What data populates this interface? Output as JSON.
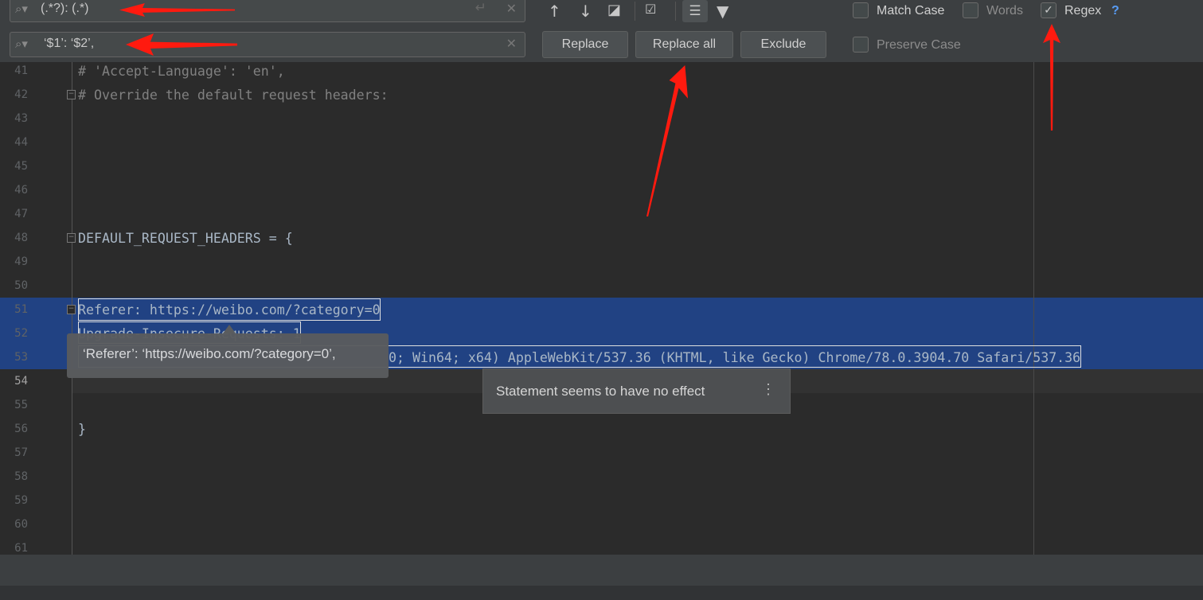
{
  "find": {
    "search_value": "(.*?): (.*)",
    "replace_value": "‘$1’: ‘$2’,"
  },
  "buttons": {
    "replace": "Replace",
    "replace_all": "Replace all",
    "exclude": "Exclude"
  },
  "options": {
    "match_case": {
      "label": "Match Case",
      "checked": false
    },
    "words": {
      "label": "Words",
      "checked": false
    },
    "regex": {
      "label": "Regex",
      "checked": true
    },
    "preserve_case": {
      "label": "Preserve Case",
      "checked": false
    },
    "help": "?"
  },
  "lines": [
    {
      "n": "41",
      "text": "# 'Accept-Language': 'en',"
    },
    {
      "n": "42",
      "text": "# Override the default request headers:"
    },
    {
      "n": "43",
      "text": ""
    },
    {
      "n": "44",
      "text": ""
    },
    {
      "n": "45",
      "text": ""
    },
    {
      "n": "46",
      "text": ""
    },
    {
      "n": "47",
      "text": ""
    },
    {
      "n": "48",
      "text": "DEFAULT_REQUEST_HEADERS = {"
    },
    {
      "n": "49",
      "text": ""
    },
    {
      "n": "50",
      "text": ""
    },
    {
      "n": "51",
      "text": "Referer: https://weibo.com/?category=0"
    },
    {
      "n": "52",
      "text": "Upgrade-Insecure-Requests: 1"
    },
    {
      "n": "53",
      "text": "0; Win64; x64) AppleWebKit/537.36 (KHTML, like Gecko) Chrome/78.0.3904.70 Safari/537.36"
    },
    {
      "n": "54",
      "text": ""
    },
    {
      "n": "55",
      "text": ""
    },
    {
      "n": "56",
      "text": "}"
    },
    {
      "n": "57",
      "text": ""
    },
    {
      "n": "58",
      "text": ""
    },
    {
      "n": "59",
      "text": ""
    },
    {
      "n": "60",
      "text": ""
    },
    {
      "n": "61",
      "text": ""
    }
  ],
  "tooltip": "‘Referer’: ‘https://weibo.com/?category=0’,",
  "inspection_popup": "Statement seems to have no effect",
  "colors": {
    "selection": "#214283",
    "annotation_arrow": "#ff1a0f",
    "number": "#6897bb"
  }
}
